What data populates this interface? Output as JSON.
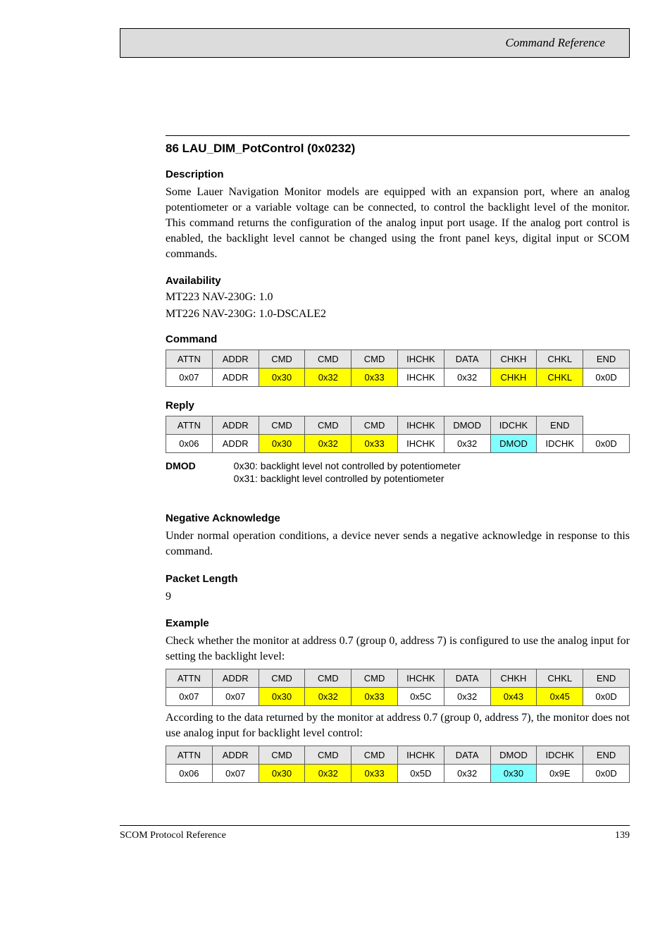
{
  "header": {
    "title": "Command Reference"
  },
  "section": {
    "title": "86 LAU_DIM_PotControl (0x0232)",
    "desc_label": "Description",
    "description": "Some Lauer Navigation Monitor models are equipped with an expansion port, where an analog potentiometer or a variable voltage can be connected, to control the backlight level of the monitor. This command returns the configuration of the analog input port usage. If the analog port control is enabled, the backlight level cannot be changed using the front panel keys, digital input or SCOM commands.",
    "avail_label": "Availability",
    "firmware1": "MT223 NAV-230G: 1.0",
    "firmware2": "MT226 NAV-230G: 1.0-DSCALE2",
    "cmd_label": "Command",
    "reply_label": "Reply",
    "cmd_headers": [
      "ATTN",
      "ADDR",
      "CMD",
      "CMD",
      "CMD",
      "IHCHK",
      "DATA",
      "CHKH",
      "CHKL",
      "END"
    ],
    "cmd_values": [
      "0x07",
      "ADDR",
      "0x30",
      "0x32",
      "0x33",
      "IHCHK",
      "0x32",
      "CHKH",
      "CHKL",
      "0x0D"
    ],
    "rep_headers": [
      "ATTN",
      "ADDR",
      "CMD",
      "CMD",
      "CMD",
      "IHCHK",
      "DMOD",
      "IDCHK",
      "END"
    ],
    "rep_values": [
      "0x06",
      "ADDR",
      "0x30",
      "0x32",
      "0x33",
      "IHCHK",
      "0x32",
      "DMOD",
      "IDCHK",
      "0x0D"
    ],
    "field_label": "DMOD",
    "field_line1": "0x30: backlight level not controlled by potentiometer",
    "field_line2": "0x31: backlight level controlled by potentiometer",
    "nak_label": "Negative Acknowledge",
    "nak_text": "Under normal operation conditions, a device never sends a negative acknowledge in response to this command.",
    "len_label": "Packet Length",
    "len_value": "9",
    "ex_label": "Example",
    "ex_intro": "Check whether the monitor at address 0.7 (group 0, address 7) is configured to use the analog input for setting the backlight level:",
    "ex_cmd_headers": [
      "ATTN",
      "ADDR",
      "CMD",
      "CMD",
      "CMD",
      "IHCHK",
      "DATA",
      "CHKH",
      "CHKL",
      "END"
    ],
    "ex_cmd_values": [
      "0x07",
      "0x07",
      "0x30",
      "0x32",
      "0x33",
      "0x5C",
      "0x32",
      "0x43",
      "0x45",
      "0x0D"
    ],
    "ex_reply_intro": "According to the data returned by the monitor at address 0.7 (group 0, address 7), the monitor does not use analog input for backlight level control:",
    "ex_rep_headers": [
      "ATTN",
      "ADDR",
      "CMD",
      "CMD",
      "CMD",
      "IHCHK",
      "DATA",
      "DMOD",
      "IDCHK",
      "END"
    ],
    "ex_rep_values": [
      "0x06",
      "0x07",
      "0x30",
      "0x32",
      "0x33",
      "0x5D",
      "0x32",
      "0x30",
      "0x9E",
      "0x0D"
    ]
  },
  "footer": {
    "left": "SCOM Protocol Reference",
    "right": "139"
  }
}
